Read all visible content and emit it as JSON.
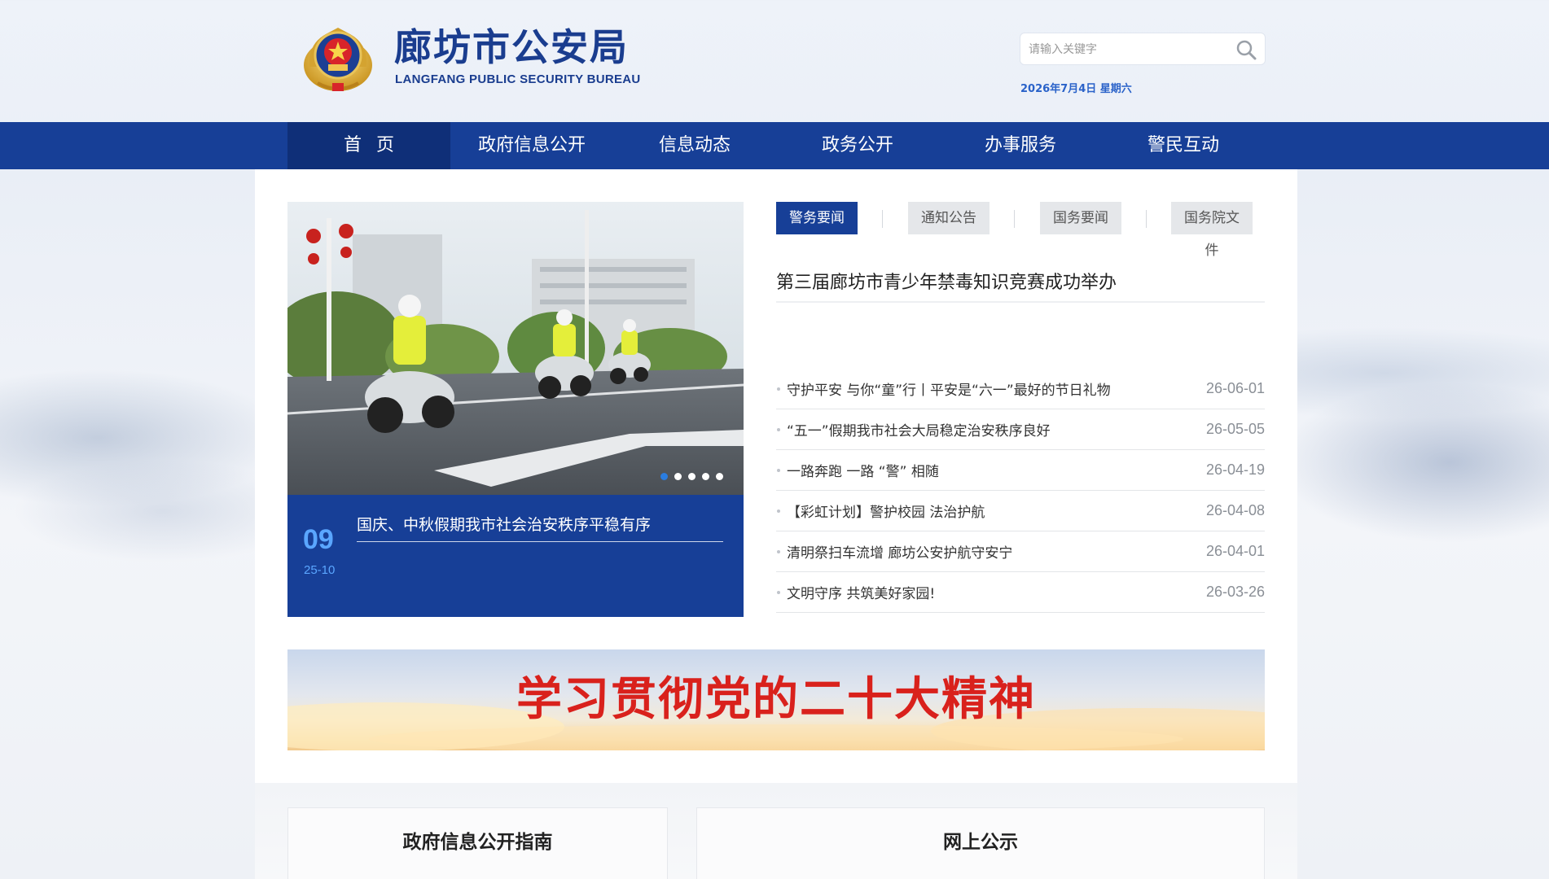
{
  "site": {
    "title": "廊坊市公安局",
    "subtitle": "LANGFANG PUBLIC SECURITY BUREAU",
    "brand_color": "#173f97"
  },
  "search": {
    "placeholder": "请输入关键字",
    "icon": "search-icon"
  },
  "date_text": "2026年7月4日 星期六",
  "nav": {
    "items": [
      {
        "label": "首页",
        "active": true
      },
      {
        "label": "政府信息公开"
      },
      {
        "label": "信息动态"
      },
      {
        "label": "政务公开"
      },
      {
        "label": "办事服务"
      },
      {
        "label": "警民互动"
      }
    ]
  },
  "carousel": {
    "day": "09",
    "year_month": "25-10",
    "caption": "国庆、中秋假期我市社会治安秩序平稳有序",
    "dots_count": 5,
    "active_dot": 1
  },
  "tabs": [
    {
      "label": "警务要闻",
      "active": true
    },
    {
      "label": "通知公告"
    },
    {
      "label": "国务要闻"
    },
    {
      "label": "国务院文件"
    }
  ],
  "headline": "第三届廊坊市青少年禁毒知识竞赛成功举办",
  "news": [
    {
      "title": "守护平安 与你“童”行丨平安是“六一”最好的节日礼物",
      "date": "26-06-01"
    },
    {
      "title": "“五一”假期我市社会大局稳定治安秩序良好",
      "date": "26-05-05"
    },
    {
      "title": "一路奔跑 一路 “警” 相随",
      "date": "26-04-19"
    },
    {
      "title": "【彩虹计划】警护校园 法治护航",
      "date": "26-04-08"
    },
    {
      "title": "清明祭扫车流增 廊坊公安护航守安宁",
      "date": "26-04-01"
    },
    {
      "title": "文明守序 共筑美好家园!",
      "date": "26-03-26"
    }
  ],
  "banner": {
    "text": "学习贯彻党的二十大精神",
    "text_color": "#d9211c"
  },
  "cards": [
    {
      "title": "政府信息公开指南"
    },
    {
      "title": "网上公示"
    }
  ]
}
